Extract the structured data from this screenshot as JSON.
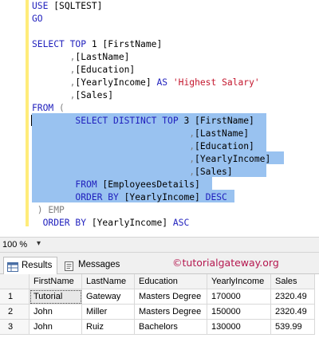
{
  "editor": {
    "lines": [
      [
        {
          "t": "USE ",
          "c": "kw"
        },
        {
          "t": "[SQLTEST]",
          "c": ""
        }
      ],
      [
        {
          "t": "GO",
          "c": "kw"
        }
      ],
      [],
      [
        {
          "t": "SELECT TOP ",
          "c": "kw"
        },
        {
          "t": "1 [FirstName]",
          "c": ""
        }
      ],
      [
        {
          "t": "       ,",
          "c": "gray"
        },
        {
          "t": "[LastName]",
          "c": ""
        }
      ],
      [
        {
          "t": "       ,",
          "c": "gray"
        },
        {
          "t": "[Education]",
          "c": ""
        }
      ],
      [
        {
          "t": "       ,",
          "c": "gray"
        },
        {
          "t": "[YearlyIncome] ",
          "c": ""
        },
        {
          "t": "AS ",
          "c": "kw"
        },
        {
          "t": "'Highest Salary'",
          "c": "str"
        }
      ],
      [
        {
          "t": "       ,",
          "c": "gray"
        },
        {
          "t": "[Sales]",
          "c": ""
        }
      ],
      [
        {
          "t": "FROM ",
          "c": "kw"
        },
        {
          "t": "(",
          "c": "gray"
        }
      ],
      [
        {
          "t": "        SELECT DISTINCT TOP ",
          "c": "kw"
        },
        {
          "t": "3 [FirstName]",
          "c": ""
        }
      ],
      [
        {
          "t": "                             ,",
          "c": "gray"
        },
        {
          "t": "[LastName]",
          "c": ""
        }
      ],
      [
        {
          "t": "                             ,",
          "c": "gray"
        },
        {
          "t": "[Education]",
          "c": ""
        }
      ],
      [
        {
          "t": "                             ,",
          "c": "gray"
        },
        {
          "t": "[YearlyIncome]",
          "c": ""
        }
      ],
      [
        {
          "t": "                             ,",
          "c": "gray"
        },
        {
          "t": "[Sales]",
          "c": ""
        }
      ],
      [
        {
          "t": "        FROM ",
          "c": "kw"
        },
        {
          "t": "[EmployeesDetails]",
          "c": ""
        }
      ],
      [
        {
          "t": "        ORDER BY ",
          "c": "kw"
        },
        {
          "t": "[YearlyIncome] ",
          "c": ""
        },
        {
          "t": "DESC",
          "c": "kw"
        }
      ],
      [
        {
          "t": " ) EMP",
          "c": "gray"
        }
      ],
      [
        {
          "t": "  ORDER BY ",
          "c": "kw"
        },
        {
          "t": "[YearlyIncome] ",
          "c": ""
        },
        {
          "t": "ASC",
          "c": "kw"
        }
      ]
    ]
  },
  "zoom": {
    "value": "100 %"
  },
  "tabs": {
    "results": "Results",
    "messages": "Messages"
  },
  "watermark": "©tutorialgateway.org",
  "grid": {
    "columns": [
      "FirstName",
      "LastName",
      "Education",
      "YearlyIncome",
      "Sales"
    ],
    "rows": [
      {
        "num": "1",
        "cells": [
          "Tutorial",
          "Gateway",
          "Masters Degree",
          "170000",
          "2320.49"
        ]
      },
      {
        "num": "2",
        "cells": [
          "John",
          "Miller",
          "Masters Degree",
          "150000",
          "2320.49"
        ]
      },
      {
        "num": "3",
        "cells": [
          "John",
          "Ruiz",
          "Bachelors",
          "130000",
          "539.99"
        ]
      }
    ]
  },
  "colors": {
    "keyword": "#1f1fbd",
    "string": "#c4162d",
    "selection": "#99c2f0",
    "change_bar": "#ffec7a",
    "watermark": "#b5174f"
  }
}
